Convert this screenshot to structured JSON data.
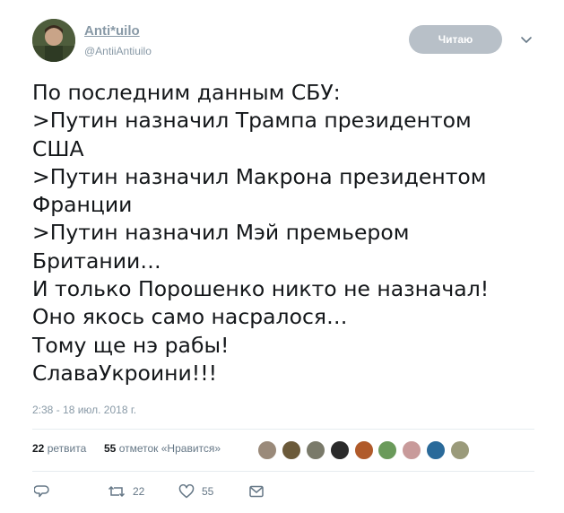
{
  "author": {
    "display_name": "Anti*uilo",
    "handle": "@AntiiAntiuilo"
  },
  "follow_button_label": "Читаю",
  "tweet_lines": [
    "По последним данным СБУ:",
    ">Путин назначил Трампа президентом",
    "США",
    ">Путин назначил Макрона президентом",
    "Франции",
    ">Путин назначил Мэй премьером",
    "Британии…",
    "И только Порошенко никто не назначал!",
    "Оно якось само насралося…",
    "Тому ще нэ рабы!",
    "СлаваУкроини!!!"
  ],
  "timestamp": "2:38 - 18 июл. 2018 г.",
  "stats": {
    "retweets_count": "22",
    "retweets_label": "ретвита",
    "likes_count": "55",
    "likes_label": "отметок «Нравится»"
  },
  "liker_avatar_colors": [
    "#9a8a7a",
    "#6b5a3a",
    "#7a7a6a",
    "#2a2a2a",
    "#b05a2a",
    "#6a9a5a",
    "#c89a9a",
    "#2a6a9a",
    "#9a9a7a"
  ],
  "actions": {
    "reply_count": "",
    "retweet_count": "22",
    "like_count": "55"
  },
  "colors": {
    "name": "#8899a6",
    "secondary": "#657786",
    "follow_button_bg": "#b8c0c8"
  }
}
